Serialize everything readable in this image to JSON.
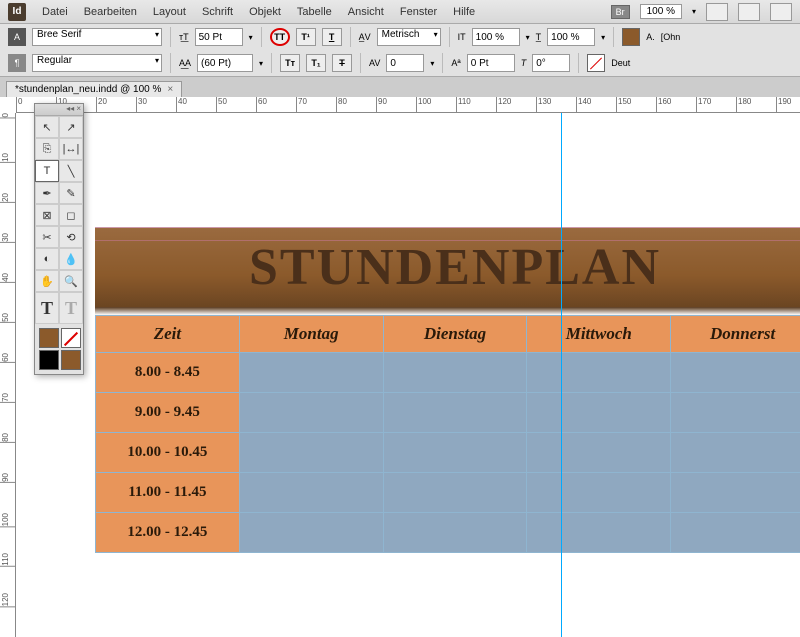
{
  "menubar": {
    "items": [
      "Datei",
      "Bearbeiten",
      "Layout",
      "Schrift",
      "Objekt",
      "Tabelle",
      "Ansicht",
      "Fenster",
      "Hilfe"
    ],
    "bridge": "Br",
    "zoom": "100 %"
  },
  "control": {
    "font": "Bree Serif",
    "style": "Regular",
    "size": "50 Pt",
    "leading": "(60 Pt)",
    "kerning": "Metrisch",
    "tracking": "0",
    "vscale": "100 %",
    "hscale": "100 %",
    "baseline": "0 Pt",
    "skew": "0°",
    "lang": "Deut",
    "ohne": "[Ohn"
  },
  "doc_tab": "*stundenplan_neu.indd @ 100 %",
  "ruler_h": [
    "0",
    "10",
    "20",
    "30",
    "40",
    "50",
    "60",
    "70",
    "80",
    "90",
    "100",
    "110",
    "120",
    "130",
    "140",
    "150",
    "160",
    "170",
    "180",
    "190"
  ],
  "ruler_v": [
    "0",
    "10",
    "20",
    "30",
    "40",
    "50",
    "60",
    "70",
    "80",
    "90",
    "100",
    "110",
    "120"
  ],
  "title": "STUNDENPLAN",
  "schedule": {
    "headers": [
      "Zeit",
      "Montag",
      "Dienstag",
      "Mittwoch",
      "Donnerst"
    ],
    "times": [
      "8.00 - 8.45",
      "9.00 - 9.45",
      "10.00 - 10.45",
      "11.00 - 11.45",
      "12.00 - 12.45"
    ]
  }
}
